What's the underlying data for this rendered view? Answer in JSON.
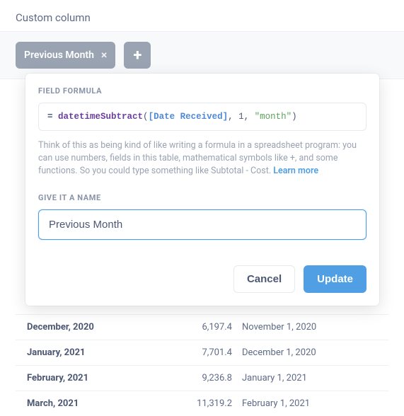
{
  "header": {
    "title": "Custom column"
  },
  "pills": {
    "items": [
      "Previous Month"
    ]
  },
  "modal": {
    "formula_label": "FIELD FORMULA",
    "formula": {
      "eq": "= ",
      "fn": "datetimeSubtract",
      "open": "(",
      "field": "[Date Received]",
      "sep1": ", ",
      "arg_num": "1",
      "sep2": ", ",
      "arg_str": "\"month\"",
      "close": ")"
    },
    "help_text": "Think of this as being kind of like writing a formula in a spreadsheet program: you can use numbers, fields in this table, mathematical symbols like +, and some functions. So you could type something like Subtotal - Cost. ",
    "learn_more": "Learn more",
    "name_label": "GIVE IT A NAME",
    "name_value": "Previous Month",
    "cancel": "Cancel",
    "update": "Update"
  },
  "table": {
    "rows": [
      {
        "month": "December, 2020",
        "value": "6,197.4",
        "prev": "November 1, 2020"
      },
      {
        "month": "January, 2021",
        "value": "7,701.4",
        "prev": "December 1, 2020"
      },
      {
        "month": "February, 2021",
        "value": "9,236.8",
        "prev": "January 1, 2021"
      },
      {
        "month": "March, 2021",
        "value": "11,319.2",
        "prev": "February 1, 2021"
      }
    ]
  }
}
